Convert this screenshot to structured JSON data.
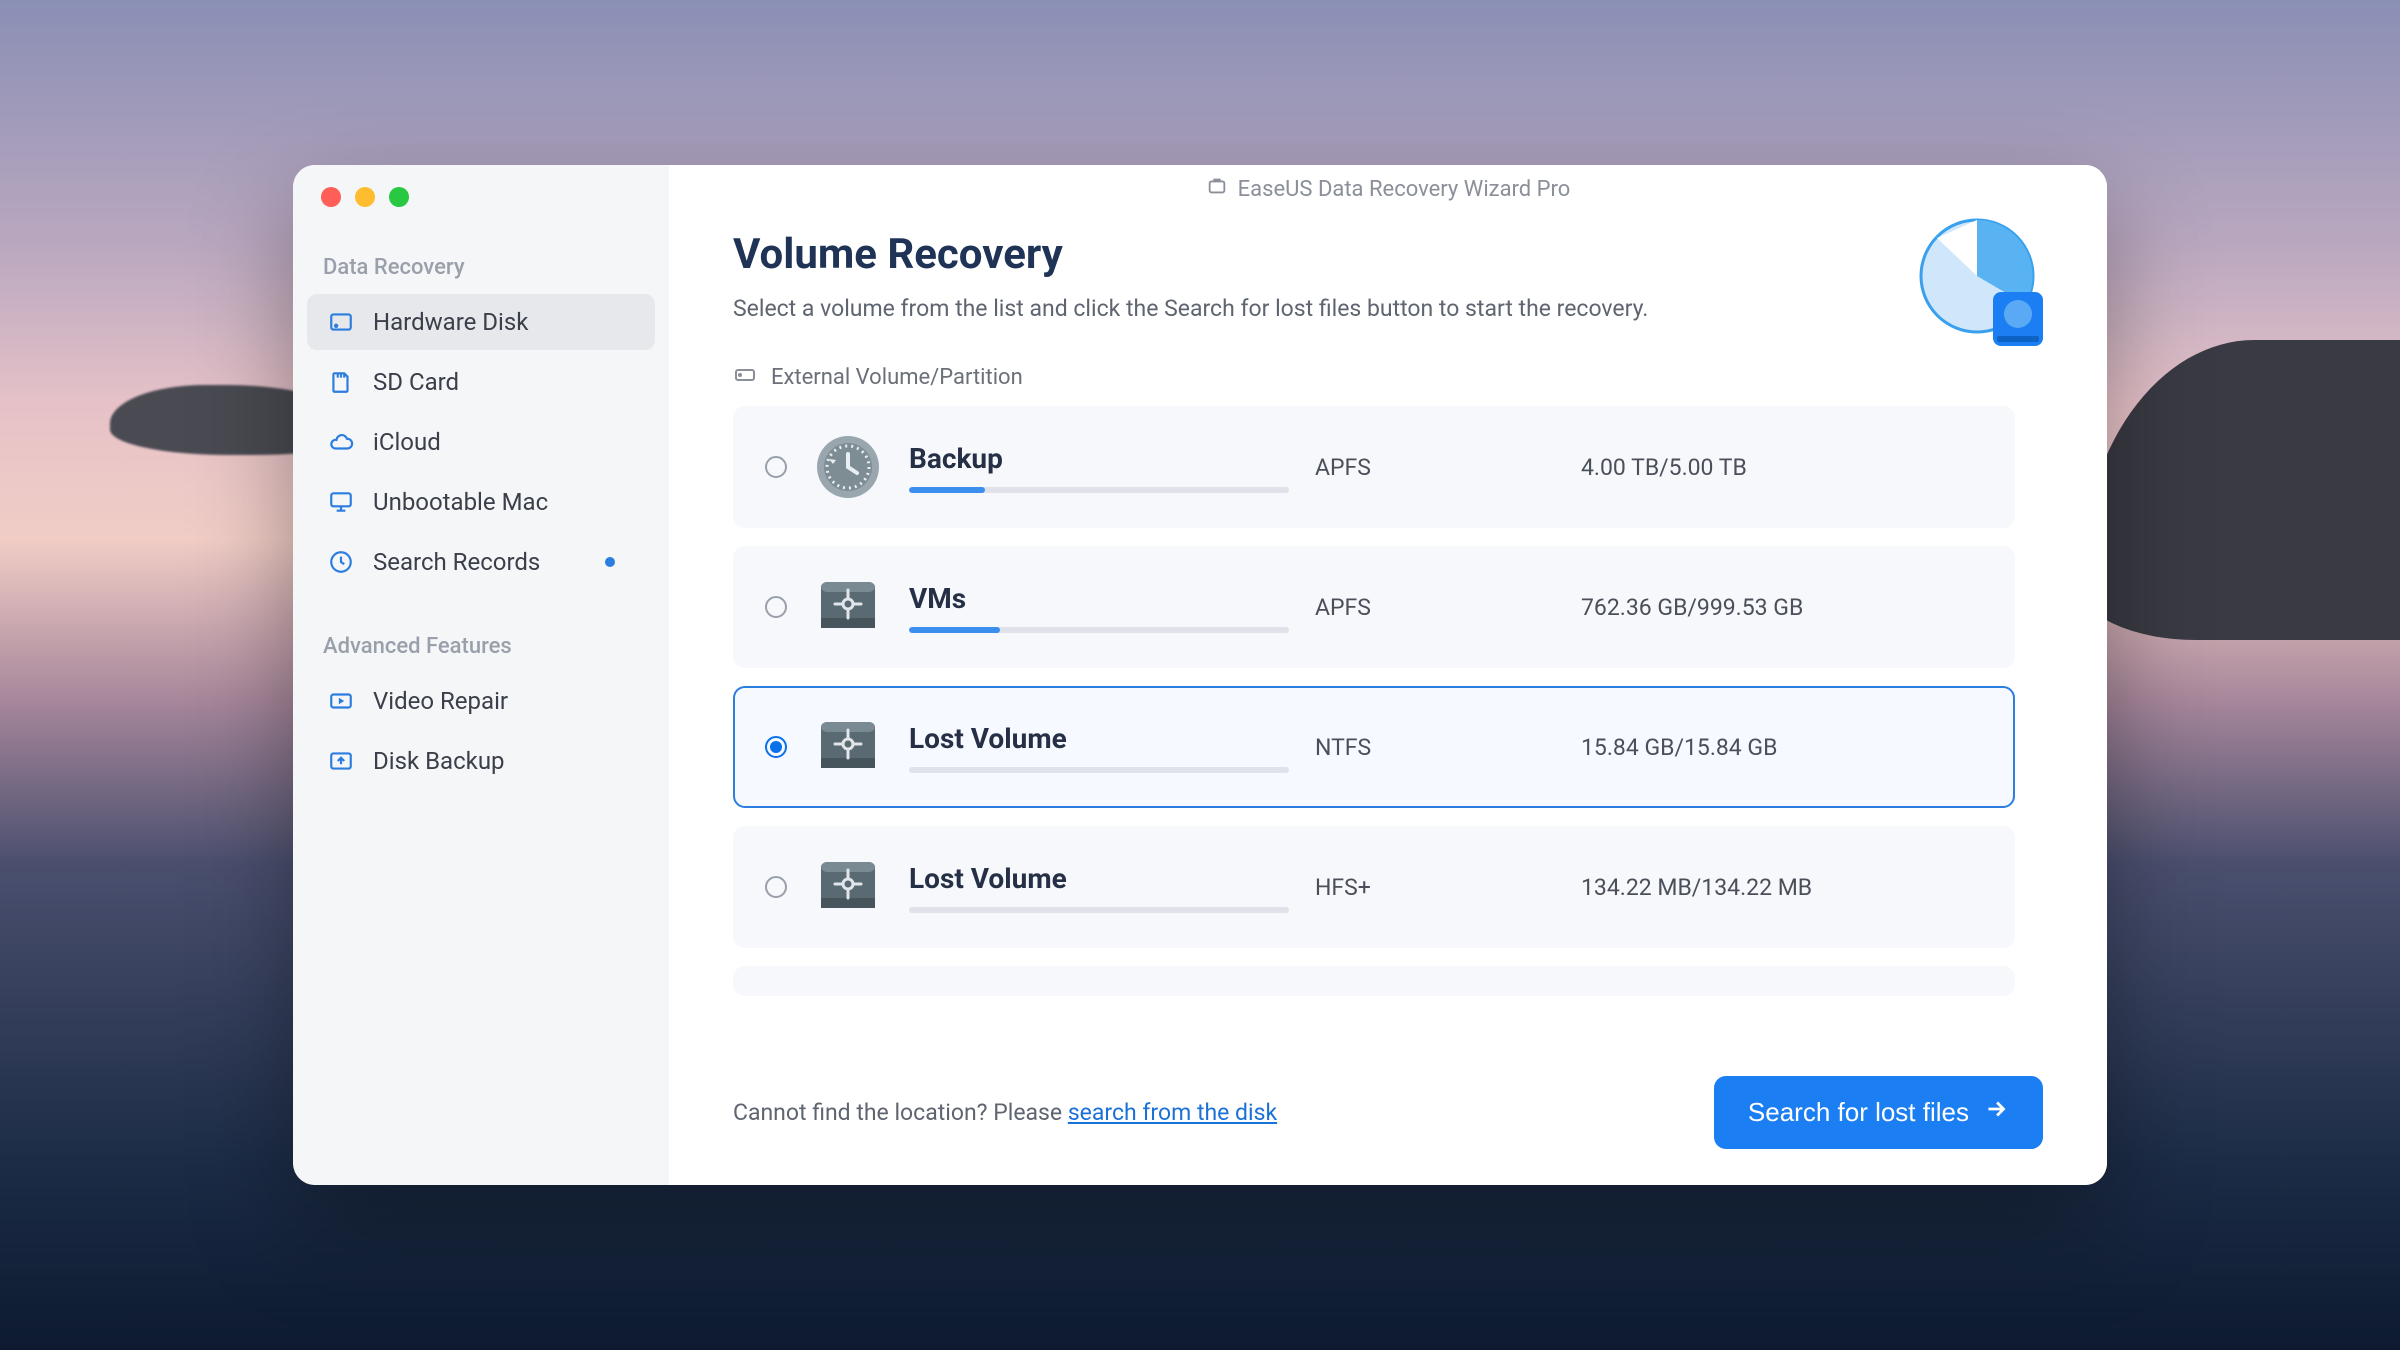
{
  "app_title": "EaseUS Data Recovery Wizard  Pro",
  "sidebar": {
    "group1_heading": "Data Recovery",
    "group2_heading": "Advanced Features",
    "items1": [
      {
        "label": "Hardware Disk",
        "active": true
      },
      {
        "label": "SD Card"
      },
      {
        "label": "iCloud"
      },
      {
        "label": "Unbootable Mac"
      },
      {
        "label": "Search Records",
        "dot": true
      }
    ],
    "items2": [
      {
        "label": "Video Repair"
      },
      {
        "label": "Disk Backup"
      }
    ]
  },
  "page": {
    "title": "Volume Recovery",
    "subtitle": "Select a volume from the list and click the Search for lost files button to start the recovery.",
    "section_heading": "External Volume/Partition"
  },
  "volumes": [
    {
      "name": "Backup",
      "fs": "APFS",
      "size": "4.00 TB/5.00 TB",
      "fill": 20,
      "icon": "timemachine",
      "selected": false
    },
    {
      "name": "VMs",
      "fs": "APFS",
      "size": "762.36 GB/999.53 GB",
      "fill": 24,
      "icon": "usb",
      "selected": false
    },
    {
      "name": "Lost Volume",
      "fs": "NTFS",
      "size": "15.84 GB/15.84 GB",
      "fill": 0,
      "icon": "usb",
      "selected": true
    },
    {
      "name": "Lost Volume",
      "fs": "HFS+",
      "size": "134.22 MB/134.22 MB",
      "fill": 0,
      "icon": "usb",
      "selected": false
    }
  ],
  "footer": {
    "prefix": "Cannot find the location? Please ",
    "link": "search from the disk",
    "button": "Search for lost files"
  }
}
